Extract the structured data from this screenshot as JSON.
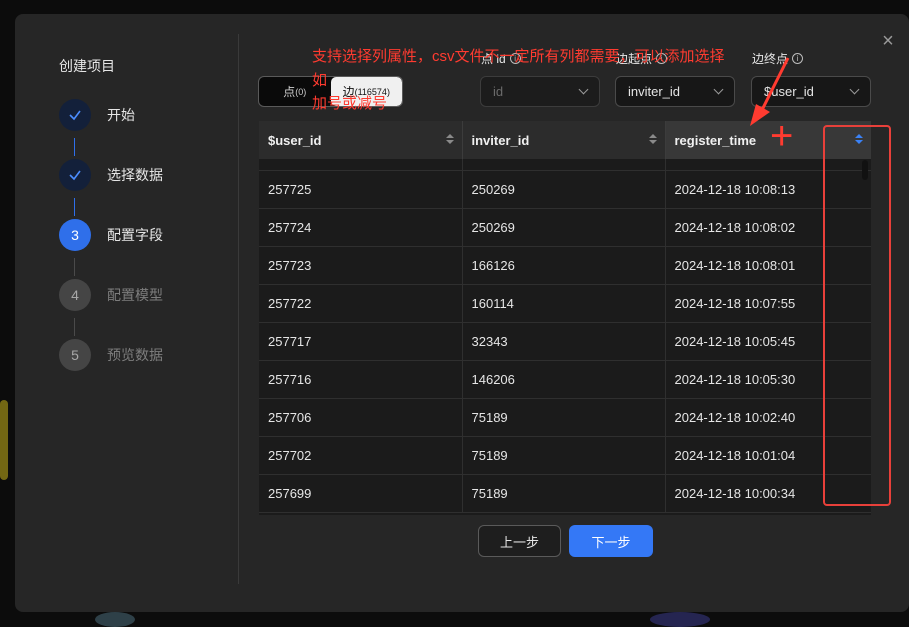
{
  "dialog": {
    "steps_title": "创建项目",
    "steps": [
      {
        "number": "✓",
        "label": "开始",
        "state": "done"
      },
      {
        "number": "✓",
        "label": "选择数据",
        "state": "done"
      },
      {
        "number": "3",
        "label": "配置字段",
        "state": "active"
      },
      {
        "number": "4",
        "label": "配置模型",
        "state": "todo"
      },
      {
        "number": "5",
        "label": "预览数据",
        "state": "todo"
      }
    ],
    "close_icon": "×"
  },
  "toggle": {
    "node_label": "点",
    "node_count": "(0)",
    "edge_label": "边",
    "edge_count": "(116574)"
  },
  "fields": {
    "node_id_label": "点 id",
    "node_id_value": "id",
    "start_label": "边起点",
    "start_value": "inviter_id",
    "end_label": "边终点",
    "end_value": "$user_id"
  },
  "table": {
    "columns": [
      "$user_id",
      "inviter_id",
      "register_time"
    ],
    "rows": [
      [
        "257725",
        "250269",
        "2024-12-18 10:08:13"
      ],
      [
        "257724",
        "250269",
        "2024-12-18 10:08:02"
      ],
      [
        "257723",
        "166126",
        "2024-12-18 10:08:01"
      ],
      [
        "257722",
        "160114",
        "2024-12-18 10:07:55"
      ],
      [
        "257717",
        "32343",
        "2024-12-18 10:05:45"
      ],
      [
        "257716",
        "146206",
        "2024-12-18 10:05:30"
      ],
      [
        "257706",
        "75189",
        "2024-12-18 10:02:40"
      ],
      [
        "257702",
        "75189",
        "2024-12-18 10:01:04"
      ],
      [
        "257699",
        "75189",
        "2024-12-18 10:00:34"
      ]
    ]
  },
  "buttons": {
    "prev": "上一步",
    "next": "下一步"
  },
  "annotation": {
    "line1": "支持选择列属性，csv文件不一定所有列都需要，可以添加选择",
    "line2": "如",
    "line3": "加号或减号",
    "plus": "+",
    "color": "#ff3b30"
  },
  "colors": {
    "accent": "#3478f6",
    "modal_bg": "#262626"
  }
}
